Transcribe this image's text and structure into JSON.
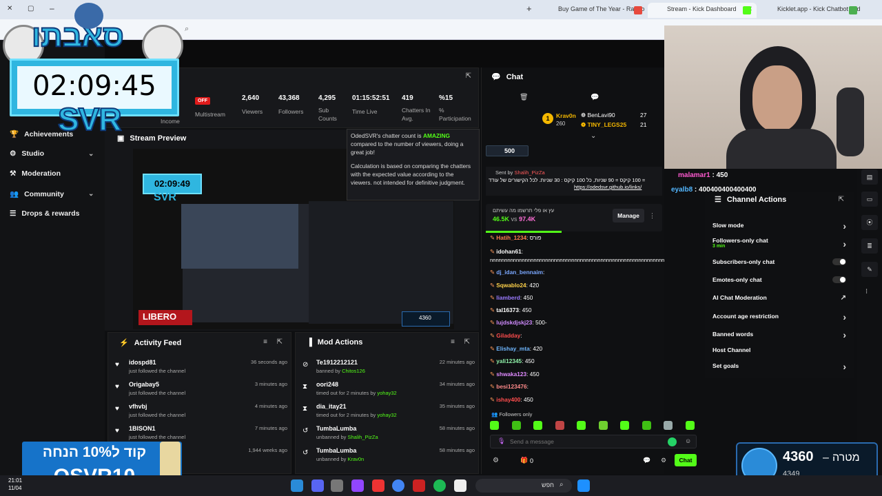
{
  "browser": {
    "tabs": [
      {
        "title": "Buy Game of The Year - Rando",
        "fav_color": "#e7493d"
      },
      {
        "title": "Stream - Kick Dashboard",
        "fav_color": "#53fc18"
      },
      {
        "title": "Kicklet.app - Kick Chatbot and",
        "fav_color": "#4caf50"
      }
    ],
    "new_tab": "+"
  },
  "overlay": {
    "logo_text": "סאבתו",
    "timer": "02:09:45",
    "timer_sub": "SVR",
    "promo_line1": "קוד ל10% הנחה",
    "promo_line2": "OSVR10",
    "goal_value": "4360",
    "goal_label": "מטרה",
    "goal_sub": "4349"
  },
  "stats": {
    "income_label": "Income",
    "status_badge": "OFF",
    "items": [
      {
        "value": "",
        "label": "Multistream"
      },
      {
        "value": "2,640",
        "label": "Viewers"
      },
      {
        "value": "43,368",
        "label": "Followers"
      },
      {
        "value": "4,295",
        "label": "Sub Counts"
      },
      {
        "value": "01:15:52:51",
        "label": "Time Live"
      },
      {
        "value": "419",
        "label": "Chatters In Avg."
      },
      {
        "value": "%15",
        "label": "% Participation"
      }
    ]
  },
  "tooltip": {
    "pre": "OdedSVR's chatter count is ",
    "highlight": "AMAZING",
    "post": " compared to the number of viewers, doing a great job!",
    "para2": "Calculation is based on comparing the chatters with the expected value according to the viewers. not intended for definitive judgment."
  },
  "sidebar": {
    "items": [
      {
        "label": "Achievements",
        "icon": "trophy-icon",
        "has_chevron": false
      },
      {
        "label": "Studio",
        "icon": "gear-icon",
        "has_chevron": true
      },
      {
        "label": "Moderation",
        "icon": "hammer-icon",
        "has_chevron": false
      },
      {
        "label": "Community",
        "icon": "people-icon",
        "has_chevron": true
      },
      {
        "label": "Drops & rewards",
        "icon": "list-icon",
        "has_chevron": false
      }
    ]
  },
  "preview": {
    "title": "Stream Preview",
    "inner_timer": "02:09:49",
    "inner_sub": "SVR",
    "libero": "LIBERO",
    "inner_goal": "4360"
  },
  "activity": {
    "title": "Activity Feed",
    "rows": [
      {
        "name": "idospd81",
        "sub": "just followed the channel",
        "time": "36 seconds ago"
      },
      {
        "name": "Origabay5",
        "sub": "just followed the channel",
        "time": "3 minutes ago"
      },
      {
        "name": "vfhvbj",
        "sub": "just followed the channel",
        "time": "4 minutes ago"
      },
      {
        "name": "1BISON1",
        "sub": "just followed the channel",
        "time": "7 minutes ago"
      },
      {
        "name": "",
        "sub": "",
        "time": "1,944 weeks ago"
      }
    ]
  },
  "mod": {
    "title": "Mod Actions",
    "rows": [
      {
        "name": "Te1912212121",
        "sub_pre": "banned by ",
        "by": "Chitos126",
        "time": "22 minutes ago",
        "icon": "ban-icon"
      },
      {
        "name": "oori248",
        "sub_pre": "timed out for 2 minutes by ",
        "by": "yohay32",
        "time": "34 minutes ago",
        "icon": "hourglass-icon"
      },
      {
        "name": "dia_itay21",
        "sub_pre": "timed out for 2 minutes by ",
        "by": "yohay32",
        "time": "35 minutes ago",
        "icon": "hourglass-icon"
      },
      {
        "name": "TumbaLumba",
        "sub_pre": "unbanned by ",
        "by": "Shalih_PizZa",
        "time": "58 minutes ago",
        "icon": "undo-icon"
      },
      {
        "name": "TumbaLumba",
        "sub_pre": "unbanned by ",
        "by": "Krav0n",
        "time": "58 minutes ago",
        "icon": "undo-icon"
      }
    ]
  },
  "chat": {
    "title": "Chat",
    "leaders": [
      {
        "rank": "1",
        "name": "Krav0n",
        "count": "260"
      },
      {
        "name": "BenLavi90",
        "count": "27"
      },
      {
        "name": "TINY_LEGS25",
        "count": "21"
      }
    ],
    "pinned_amount": "500",
    "pinned_sender_label": "Sent by",
    "pinned_sender": "Shalih_PizZa",
    "pinned_text": "= 100 קיקס = 90 שניות, כל 100 קיקס : 30 שניות. לכל הקישורים של עודד",
    "pinned_link": "https://odedsvr.github.io/links/",
    "poll_question": "עץ או פלי תרשמו מה עשיתם",
    "poll_a": "46.5K",
    "poll_vs": "vs",
    "poll_b": "97.4K",
    "manage": "Manage",
    "messages": [
      {
        "user": "Hatih_1234",
        "text": "פורס",
        "color": "#ff7f50"
      },
      {
        "user": "idohan61",
        "text": "",
        "color": "#ffffff"
      },
      {
        "user": "",
        "text": "nnnnnnnnnnnnnnnnnnnnnnnnnnnnnnnnnnnnnnnnnnnnnnnnnnnnnnnnnnnn",
        "color": "#ffffff"
      },
      {
        "user": "dj_idan_bennaim",
        "text": "",
        "color": "#7aa7ff"
      },
      {
        "user": "Sqwablo24",
        "text": "420",
        "color": "#ffd24a"
      },
      {
        "user": "liamberd",
        "text": "450",
        "color": "#9b7bff"
      },
      {
        "user": "tal16373",
        "text": "450",
        "color": "#ffffff"
      },
      {
        "user": "lujdskdjskj23",
        "text": "500-",
        "color": "#d08bff"
      },
      {
        "user": "Giladday",
        "text": "",
        "color": "#ff4d4d"
      },
      {
        "user": "Elishay_mta",
        "text": "420",
        "color": "#6fb7ff"
      },
      {
        "user": "yali12345",
        "text": "450",
        "color": "#8ef0a8"
      },
      {
        "user": "shwaka123",
        "text": "450",
        "color": "#e08bff"
      },
      {
        "user": "besi123476",
        "text": "",
        "color": "#ff8b8b"
      },
      {
        "user": "ishay400",
        "text": "450",
        "color": "#ff4d4d"
      }
    ],
    "followers_only": "Followers only",
    "placeholder": "Send a message",
    "count": "0",
    "send": "Chat"
  },
  "overlay_chat": [
    {
      "user": "malamar1",
      "text": "450"
    },
    {
      "user": "eyalb8",
      "text": "400400400400400"
    }
  ],
  "actions": {
    "title": "Channel Actions",
    "rows": [
      {
        "label": "Slow mode",
        "kind": "chev"
      },
      {
        "label": "Followers-only chat",
        "sub": "3 min",
        "kind": "chev"
      },
      {
        "label": "Subscribers-only chat",
        "kind": "toggle"
      },
      {
        "label": "Emotes-only chat",
        "kind": "toggle"
      },
      {
        "label": "AI Chat Moderation",
        "kind": "link"
      },
      {
        "label": "Account age restriction",
        "kind": "chev"
      },
      {
        "label": "Banned words",
        "kind": "chev"
      },
      {
        "label": "Host Channel",
        "kind": "none"
      },
      {
        "label": "Set goals",
        "kind": "chev"
      }
    ]
  },
  "taskbar": {
    "clock1": "21:01",
    "clock2": "11/04",
    "search": "חפש"
  }
}
